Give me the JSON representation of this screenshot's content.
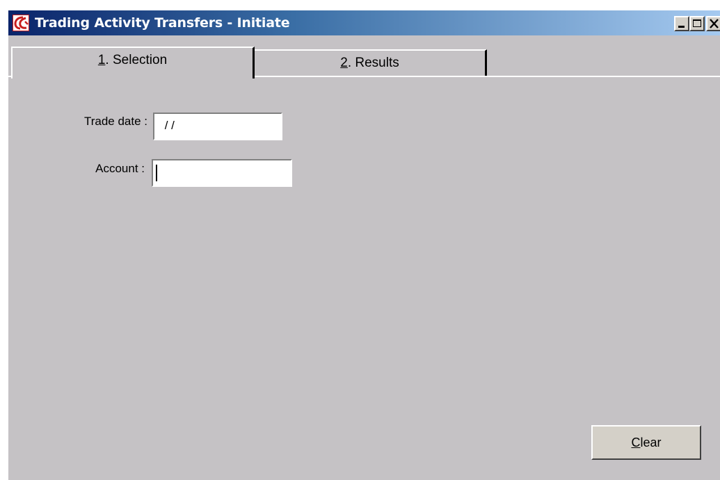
{
  "window": {
    "title": "Trading Activity Transfers - Initiate",
    "controls": [
      "minimize-icon",
      "maximize-icon",
      "close-icon"
    ]
  },
  "tabs": [
    {
      "mnemonic": "1",
      "rest": ". Selection",
      "active": true
    },
    {
      "mnemonic": "2",
      "rest": ". Results",
      "active": false
    }
  ],
  "form": {
    "trade_date_label": "Trade date :",
    "trade_date_value": " / /",
    "account_label": "Account :",
    "account_value": ""
  },
  "buttons": {
    "clear_mnemonic": "C",
    "clear_rest": "lear"
  },
  "colors": {
    "window_bg": "#c5c2c5",
    "titlebar_start": "#0a246a",
    "titlebar_end": "#a6caf0",
    "logo": "#c81e1e"
  }
}
